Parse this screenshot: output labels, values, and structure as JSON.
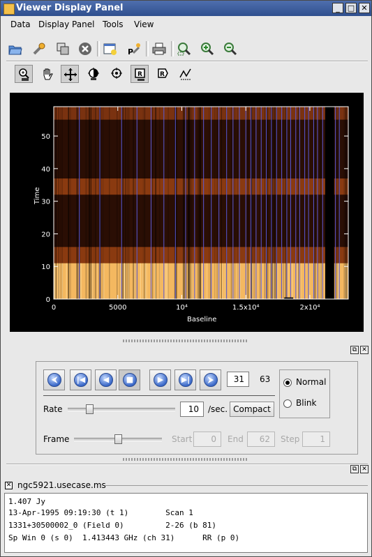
{
  "window": {
    "title": "Viewer Display Panel",
    "minimize_glyph": "_",
    "maximize_glyph": "□",
    "close_glyph": "✕"
  },
  "menubar": [
    {
      "key": "D",
      "rest": "ata"
    },
    {
      "key": "",
      "pre": "D",
      "key2": "i",
      "rest": "splay Panel"
    },
    {
      "key": "T",
      "rest": "ools"
    },
    {
      "key": "V",
      "rest": "iew"
    }
  ],
  "menu_labels": {
    "data": "Data",
    "display_panel": "Display Panel",
    "tools": "Tools",
    "view": "View"
  },
  "toolbar1": [
    "open-icon",
    "wrench-icon",
    "copy-panel-icon",
    "close-circle-icon",
    "new-panel-icon",
    "panel-options-icon",
    "print-icon",
    "zoom-box-icon",
    "zoom-in-icon",
    "zoom-out-icon"
  ],
  "toolbar2": [
    "zoom-tool-icon",
    "pan-tool-icon",
    "crosshair-move-icon",
    "contrast-tool-icon",
    "position-tool-icon",
    "rectangle-region-icon",
    "polygon-region-icon",
    "polyline-icon"
  ],
  "plot": {
    "ylabel": "Time",
    "xlabel": "Baseline",
    "yticks": [
      "0",
      "10",
      "20",
      "30",
      "40",
      "50"
    ],
    "xticks": [
      "0",
      "5000",
      "10⁴",
      "1.5x10⁴",
      "2x10⁴"
    ]
  },
  "chart_data": {
    "type": "heatmap",
    "xlabel": "Baseline",
    "ylabel": "Time",
    "xlim": [
      0,
      23000
    ],
    "ylim": [
      0,
      59
    ],
    "x_tick_labels": [
      "0",
      "5000",
      "10^4",
      "1.5x10^4",
      "2x10^4"
    ],
    "y_tick_labels": [
      "0",
      "10",
      "20",
      "30",
      "40",
      "50"
    ],
    "bands": [
      {
        "time_from": 0,
        "time_to": 11,
        "intensity": "high",
        "color": "#f4b860"
      },
      {
        "time_from": 11,
        "time_to": 16,
        "intensity": "medium",
        "color": "#8a3a10"
      },
      {
        "time_from": 16,
        "time_to": 32,
        "intensity": "low",
        "color": "#2a0e04"
      },
      {
        "time_from": 32,
        "time_to": 37,
        "intensity": "medium",
        "color": "#8a3a10"
      },
      {
        "time_from": 37,
        "time_to": 55,
        "intensity": "low",
        "color": "#2a0e04"
      },
      {
        "time_from": 55,
        "time_to": 59,
        "intensity": "medium",
        "color": "#7a3210"
      }
    ],
    "grid": false
  },
  "animator": {
    "frame_value": "31",
    "frame_total": "63",
    "rate_label": "Rate",
    "rate_value": "10",
    "rate_unit": "/sec.",
    "compact_label": "Compact",
    "frame_label": "Frame",
    "start_label": "Start",
    "start_value": "0",
    "end_label": "End",
    "end_value": "62",
    "step_label": "Step",
    "step_value": "1",
    "rate_slider_level": 0.2,
    "frame_slider_level": 0.5,
    "mode_normal": "Normal",
    "mode_blink": "Blink",
    "buttons": [
      "rewind-icon",
      "to-start-icon",
      "step-back-icon",
      "stop-icon",
      "step-forward-icon",
      "to-end-icon",
      "play-forward-icon"
    ],
    "glyphs": [
      "⮜",
      "|◀",
      "◀",
      "■",
      "▶",
      "▶|",
      "⮞"
    ]
  },
  "tracking": {
    "title": "ngc5921.usecase.ms",
    "lines": [
      "1.407 Jy",
      "13-Apr-1995 09:19:30 (t 1)        Scan 1",
      "1331+30500002_0 (Field 0)         2-26 (b 81)",
      "Sp Win 0 (s 0)  1.413443 GHz (ch 31)      RR (p 0)"
    ]
  },
  "colors": {
    "title_bar": "#3a5a9a",
    "accent": "#3a68c8"
  }
}
